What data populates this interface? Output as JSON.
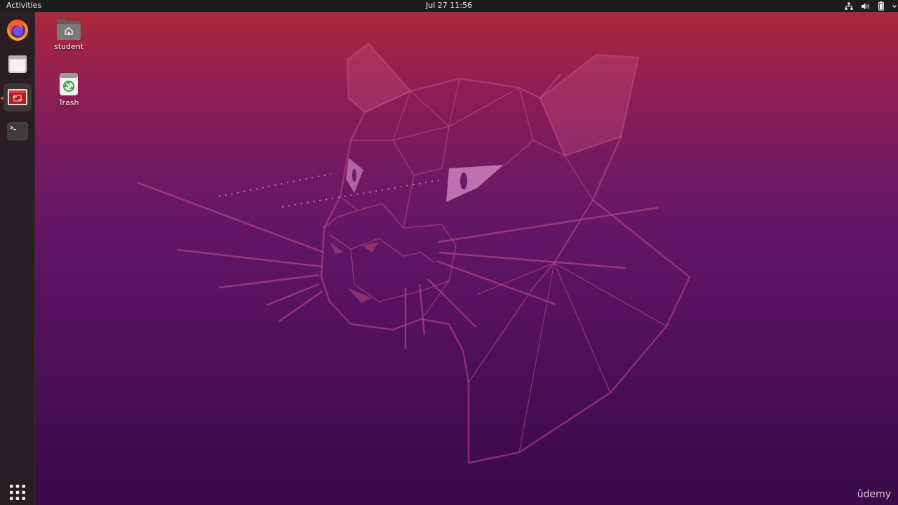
{
  "topbar": {
    "activities_label": "Activities",
    "datetime": "Jul 27  11:56",
    "tray_icons": [
      "network-icon",
      "volume-icon",
      "battery-icon",
      "system-menu-chevron-icon"
    ]
  },
  "dock": {
    "items": [
      {
        "name": "Firefox",
        "icon": "firefox-icon"
      },
      {
        "name": "Files",
        "icon": "files-icon"
      },
      {
        "name": "Remote Desktop",
        "icon": "remote-desktop-icon",
        "running": true
      },
      {
        "name": "Terminal",
        "icon": "terminal-icon"
      }
    ],
    "show_apps_icon": "apps-grid-icon",
    "accent_color": "#e95420"
  },
  "desktop": {
    "icons": [
      {
        "label": "student",
        "icon": "home-folder-icon"
      },
      {
        "label": "Trash",
        "icon": "trash-icon"
      }
    ]
  },
  "wallpaper": {
    "subject": "focal-fossa-icon",
    "colors": {
      "top": "#b02a33",
      "bottom": "#3b0a48"
    }
  },
  "watermark": {
    "text": "ûdemy"
  }
}
